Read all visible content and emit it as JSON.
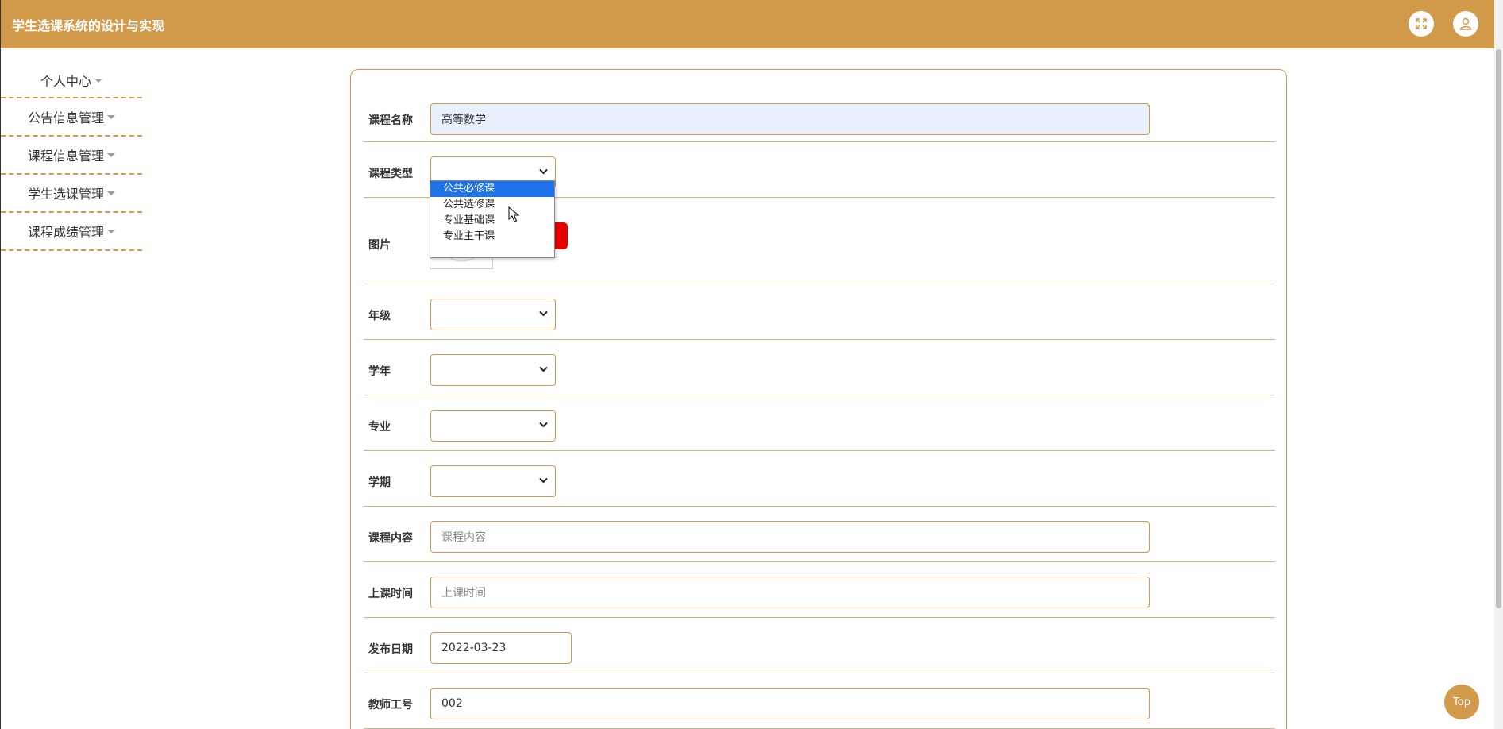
{
  "app": {
    "title": "学生选课系统的设计与实现"
  },
  "header": {
    "fullscreen_icon": "expand-icon",
    "user_icon": "user-icon"
  },
  "sidebar": {
    "items": [
      {
        "label": "个人中心"
      },
      {
        "label": "公告信息管理"
      },
      {
        "label": "课程信息管理"
      },
      {
        "label": "学生选课管理"
      },
      {
        "label": "课程成绩管理"
      }
    ]
  },
  "form": {
    "course_name": {
      "label": "课程名称",
      "value": "高等数学"
    },
    "course_type": {
      "label": "课程类型",
      "value": "",
      "options": [
        "公共必修课",
        "公共选修课",
        "专业基础课",
        "专业主干课"
      ],
      "highlighted": "公共必修课"
    },
    "image": {
      "label": "图片"
    },
    "grade": {
      "label": "年级",
      "value": ""
    },
    "school_year": {
      "label": "学年",
      "value": ""
    },
    "major": {
      "label": "专业",
      "value": ""
    },
    "semester": {
      "label": "学期",
      "value": ""
    },
    "content": {
      "label": "课程内容",
      "placeholder": "课程内容"
    },
    "class_time": {
      "label": "上课时间",
      "placeholder": "上课时间"
    },
    "publish_date": {
      "label": "发布日期",
      "value": "2022-03-23"
    },
    "teacher_id": {
      "label": "教师工号",
      "value": "002"
    }
  },
  "back_to_top": {
    "label": "Top"
  },
  "colors": {
    "accent": "#d29a4b",
    "highlight": "#1e73e8",
    "upload_button": "#e60000"
  }
}
